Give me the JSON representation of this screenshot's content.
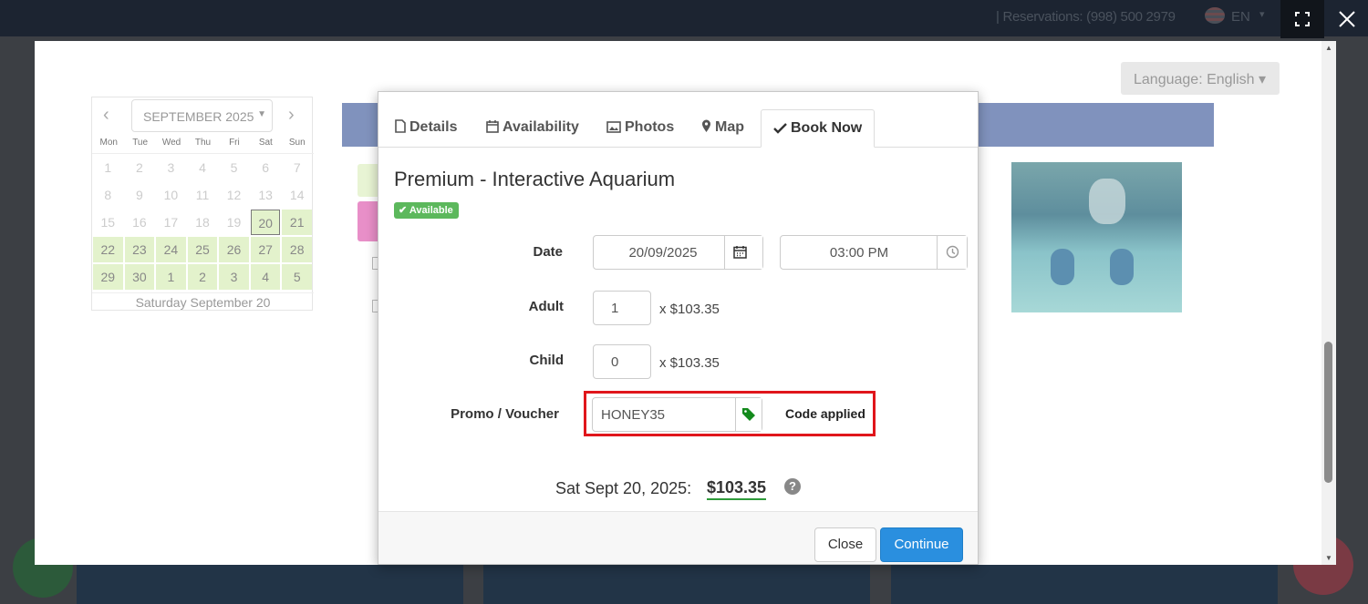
{
  "topbar": {
    "reservations": "| Reservations: (998) 500 2979",
    "language_code": "EN"
  },
  "frame": {
    "language_button": "Language: English ▾"
  },
  "calendar": {
    "month_label": "SEPTEMBER 2025",
    "weekdays": [
      "Mon",
      "Tue",
      "Wed",
      "Thu",
      "Fri",
      "Sat",
      "Sun"
    ],
    "days": [
      {
        "d": "1",
        "state": "off"
      },
      {
        "d": "2",
        "state": "off"
      },
      {
        "d": "3",
        "state": "off"
      },
      {
        "d": "4",
        "state": "off"
      },
      {
        "d": "5",
        "state": "off"
      },
      {
        "d": "6",
        "state": "off"
      },
      {
        "d": "7",
        "state": "off"
      },
      {
        "d": "8",
        "state": "off"
      },
      {
        "d": "9",
        "state": "off"
      },
      {
        "d": "10",
        "state": "off"
      },
      {
        "d": "11",
        "state": "off"
      },
      {
        "d": "12",
        "state": "off"
      },
      {
        "d": "13",
        "state": "off"
      },
      {
        "d": "14",
        "state": "off"
      },
      {
        "d": "15",
        "state": "off"
      },
      {
        "d": "16",
        "state": "off"
      },
      {
        "d": "17",
        "state": "off"
      },
      {
        "d": "18",
        "state": "off"
      },
      {
        "d": "19",
        "state": "off"
      },
      {
        "d": "20",
        "state": "sel"
      },
      {
        "d": "21",
        "state": "avail"
      },
      {
        "d": "22",
        "state": "avail"
      },
      {
        "d": "23",
        "state": "avail"
      },
      {
        "d": "24",
        "state": "avail"
      },
      {
        "d": "25",
        "state": "avail"
      },
      {
        "d": "26",
        "state": "avail"
      },
      {
        "d": "27",
        "state": "avail"
      },
      {
        "d": "28",
        "state": "avail"
      },
      {
        "d": "29",
        "state": "avail"
      },
      {
        "d": "30",
        "state": "avail"
      },
      {
        "d": "1",
        "state": "avail"
      },
      {
        "d": "2",
        "state": "avail"
      },
      {
        "d": "3",
        "state": "avail"
      },
      {
        "d": "4",
        "state": "avail"
      },
      {
        "d": "5",
        "state": "avail"
      }
    ],
    "footer": "Saturday September 20"
  },
  "modal": {
    "tabs": [
      "Details",
      "Availability",
      "Photos",
      "Map",
      "Book Now"
    ],
    "active_tab": "Book Now",
    "title": "Premium - Interactive Aquarium",
    "badge": "Available",
    "date_label": "Date",
    "date_value": "20/09/2025",
    "time_value": "03:00 PM",
    "adult_label": "Adult",
    "adult_qty": "1",
    "adult_price": "x $103.35",
    "child_label": "Child",
    "child_qty": "0",
    "child_price": "x $103.35",
    "promo_label": "Promo / Voucher",
    "promo_value": "HONEY35",
    "promo_status": "Code applied",
    "summary_date": "Sat Sept 20, 2025:",
    "summary_total": "$103.35",
    "close_label": "Close",
    "continue_label": "Continue"
  },
  "colors": {
    "accent_blue": "#2a8fdf",
    "available_green": "#5cb85c",
    "promo_highlight": "#e0161b"
  }
}
